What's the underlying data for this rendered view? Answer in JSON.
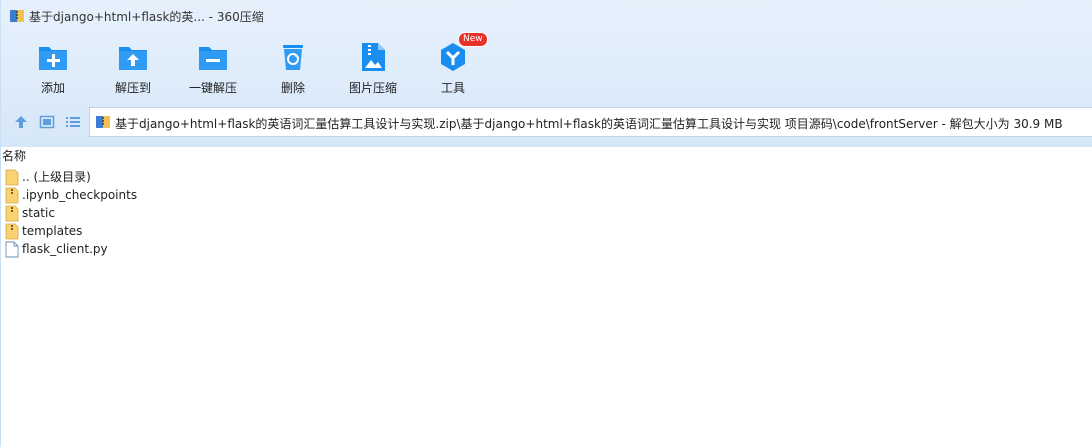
{
  "window": {
    "title": "基于django+html+flask的英... - 360压缩"
  },
  "toolbar": {
    "buttons": [
      {
        "label": "添加",
        "icon": "add-folder-icon"
      },
      {
        "label": "解压到",
        "icon": "extract-to-icon"
      },
      {
        "label": "一键解压",
        "icon": "one-click-extract-icon"
      },
      {
        "label": "删除",
        "icon": "recycle-bin-icon"
      },
      {
        "label": "图片压缩",
        "icon": "image-compress-icon"
      },
      {
        "label": "工具",
        "icon": "tools-icon",
        "badge": "New"
      }
    ]
  },
  "nav": {
    "address": "基于django+html+flask的英语词汇量估算工具设计与实现.zip\\基于django+html+flask的英语词汇量估算工具设计与实现 项目源码\\code\\frontServer - 解包大小为 30.9 MB"
  },
  "list": {
    "column_name": "名称",
    "items": [
      {
        "name": ".. (上级目录)",
        "icon": "folder-icon"
      },
      {
        "name": ".ipynb_checkpoints",
        "icon": "zip-folder-icon"
      },
      {
        "name": "static",
        "icon": "zip-folder-icon"
      },
      {
        "name": "templates",
        "icon": "zip-folder-icon"
      },
      {
        "name": "flask_client.py",
        "icon": "file-icon"
      }
    ]
  },
  "colors": {
    "accent": "#1a8ef0",
    "folder": "#f7cf6b",
    "badge": "#e8332b"
  }
}
